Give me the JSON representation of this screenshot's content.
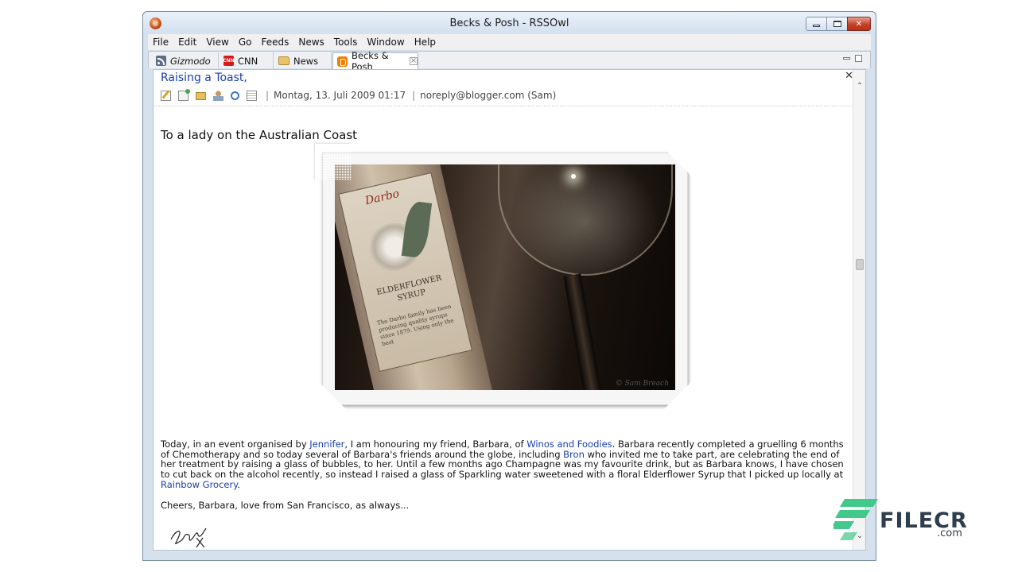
{
  "window": {
    "title": "Becks & Posh - RSSOwl"
  },
  "menubar": {
    "items": [
      "File",
      "Edit",
      "View",
      "Go",
      "Feeds",
      "News",
      "Tools",
      "Window",
      "Help"
    ]
  },
  "tabs": [
    {
      "label": "Gizmodo",
      "icon": "rss-feed-icon",
      "active": false
    },
    {
      "label": "CNN",
      "icon": "cnn-icon",
      "active": false
    },
    {
      "label": "News",
      "icon": "folder-icon",
      "active": false
    },
    {
      "label": "Becks & Posh",
      "icon": "blogger-icon",
      "active": true
    }
  ],
  "article": {
    "title": "Raising a Toast,",
    "date": "Montag, 13. Juli 2009 01:17",
    "author": "noreply@blogger.com (Sam)",
    "separator": "|",
    "subtitle": "To a lady on the Australian Coast",
    "image_label_brand": "Darbo",
    "image_label_product": "ELDERFLOWER SYRUP",
    "image_label_body": "The Darbo family has been producing quality syrups since 1879. Using only the best",
    "image_watermark": "© Sam Breach",
    "body_parts": {
      "p1": "Today, in an event organised by ",
      "link1": "Jennifer",
      "p2": ", I am honouring my friend, Barbara, of ",
      "link2": "Winos and Foodies",
      "p3": ". Barbara recently completed a gruelling 6 months of Chemotherapy and so today several of Barbara's friends around the globe, including ",
      "link3": "Bron",
      "p4": " who invited me to take part, are celebrating the end of her treatment by raising a glass of bubbles, to her. Until a few months ago Champagne was my favourite drink, but as Barbara knows, I have chosen to cut back on the alcohol recently, so instead I raised a glass of Sparkling water sweetened with a floral Elderflower Syrup that I picked up locally at ",
      "link4": "Rainbow Grocery",
      "p5": "."
    },
    "closing": "Cheers, Barbara, love from San Francisco, as always..."
  },
  "watermark": {
    "brand": "FILECR",
    "suffix": ".com"
  },
  "colors": {
    "link": "#1a3fa8",
    "close_button": "#c4412a",
    "chrome": "#d6e1ee"
  }
}
